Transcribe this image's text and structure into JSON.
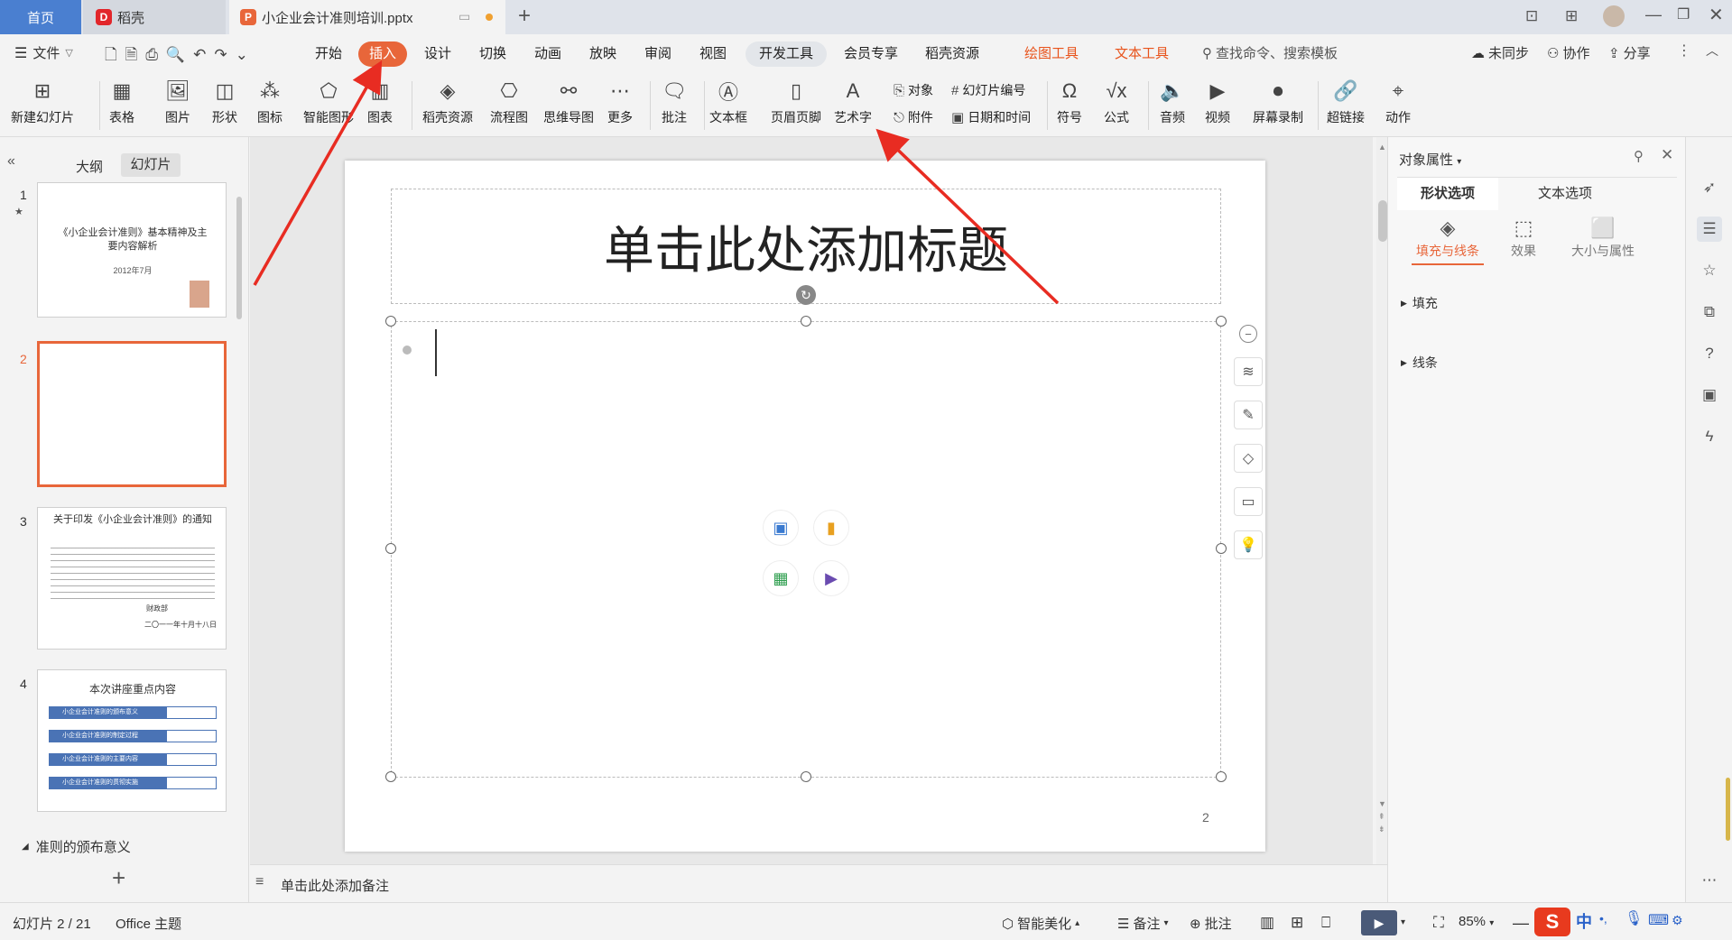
{
  "tabs": {
    "home": "首页",
    "daoke": "稻壳",
    "doc": "小企业会计准则培训.pptx",
    "add": "+"
  },
  "menu": {
    "file": "文件",
    "items": [
      "开始",
      "插入",
      "设计",
      "切换",
      "动画",
      "放映",
      "审阅",
      "视图",
      "开发工具",
      "会员专享",
      "稻壳资源"
    ],
    "drawing_tools": "绘图工具",
    "text_tools": "文本工具",
    "search_placeholder": "查找命令、搜索模板",
    "sync": "未同步",
    "collab": "协作",
    "share": "分享"
  },
  "toolbar": {
    "new_slide": "新建幻灯片",
    "table": "表格",
    "picture": "图片",
    "shape": "形状",
    "icon": "图标",
    "smart_graphic": "智能图形",
    "chart": "图表",
    "daoke_resource": "稻壳资源",
    "flowchart": "流程图",
    "mindmap": "思维导图",
    "more": "更多",
    "comment": "批注",
    "textbox": "文本框",
    "header_footer": "页眉页脚",
    "wordart": "艺术字",
    "object": "对象",
    "attachment": "附件",
    "slide_number": "幻灯片编号",
    "date_time": "日期和时间",
    "symbol": "符号",
    "formula": "公式",
    "audio": "音频",
    "video": "视频",
    "screen_record": "屏幕录制",
    "hyperlink": "超链接",
    "action": "动作"
  },
  "left_panel": {
    "outline_tab": "大纲",
    "slides_tab": "幻灯片",
    "section_label": "准则的颁布意义",
    "slides": [
      {
        "num": "1",
        "title": "《小企业会计准则》基本精神及主要内容解析",
        "date": "2012年7月"
      },
      {
        "num": "2",
        "title": ""
      },
      {
        "num": "3",
        "title": "关于印发《小企业会计准则》的通知",
        "sign1": "财政部",
        "sign2": "二〇一一年十月十八日"
      },
      {
        "num": "4",
        "title": "本次讲座重点内容",
        "items": [
          "小企业会计准则的颁布意义",
          "小企业会计准则的制定过程",
          "小企业会计准则的主要内容",
          "小企业会计准则的贯彻实施"
        ]
      }
    ]
  },
  "slide": {
    "title_placeholder": "单击此处添加标题",
    "page_number": "2"
  },
  "notes_placeholder": "单击此处添加备注",
  "right_panel": {
    "title": "对象属性",
    "tab_shape": "形状选项",
    "tab_text": "文本选项",
    "sub_fill_line": "填充与线条",
    "sub_effect": "效果",
    "sub_size": "大小与属性",
    "section_fill": "填充",
    "section_line": "线条"
  },
  "status": {
    "slide_info": "幻灯片 2 / 21",
    "theme": "Office 主题",
    "beautify": "智能美化",
    "notes": "备注",
    "comments": "批注",
    "zoom": "85%"
  },
  "colors": {
    "accent": "#e8663a",
    "active_tab_blue": "#4a7fd0",
    "arrow_red": "#e82c22"
  }
}
